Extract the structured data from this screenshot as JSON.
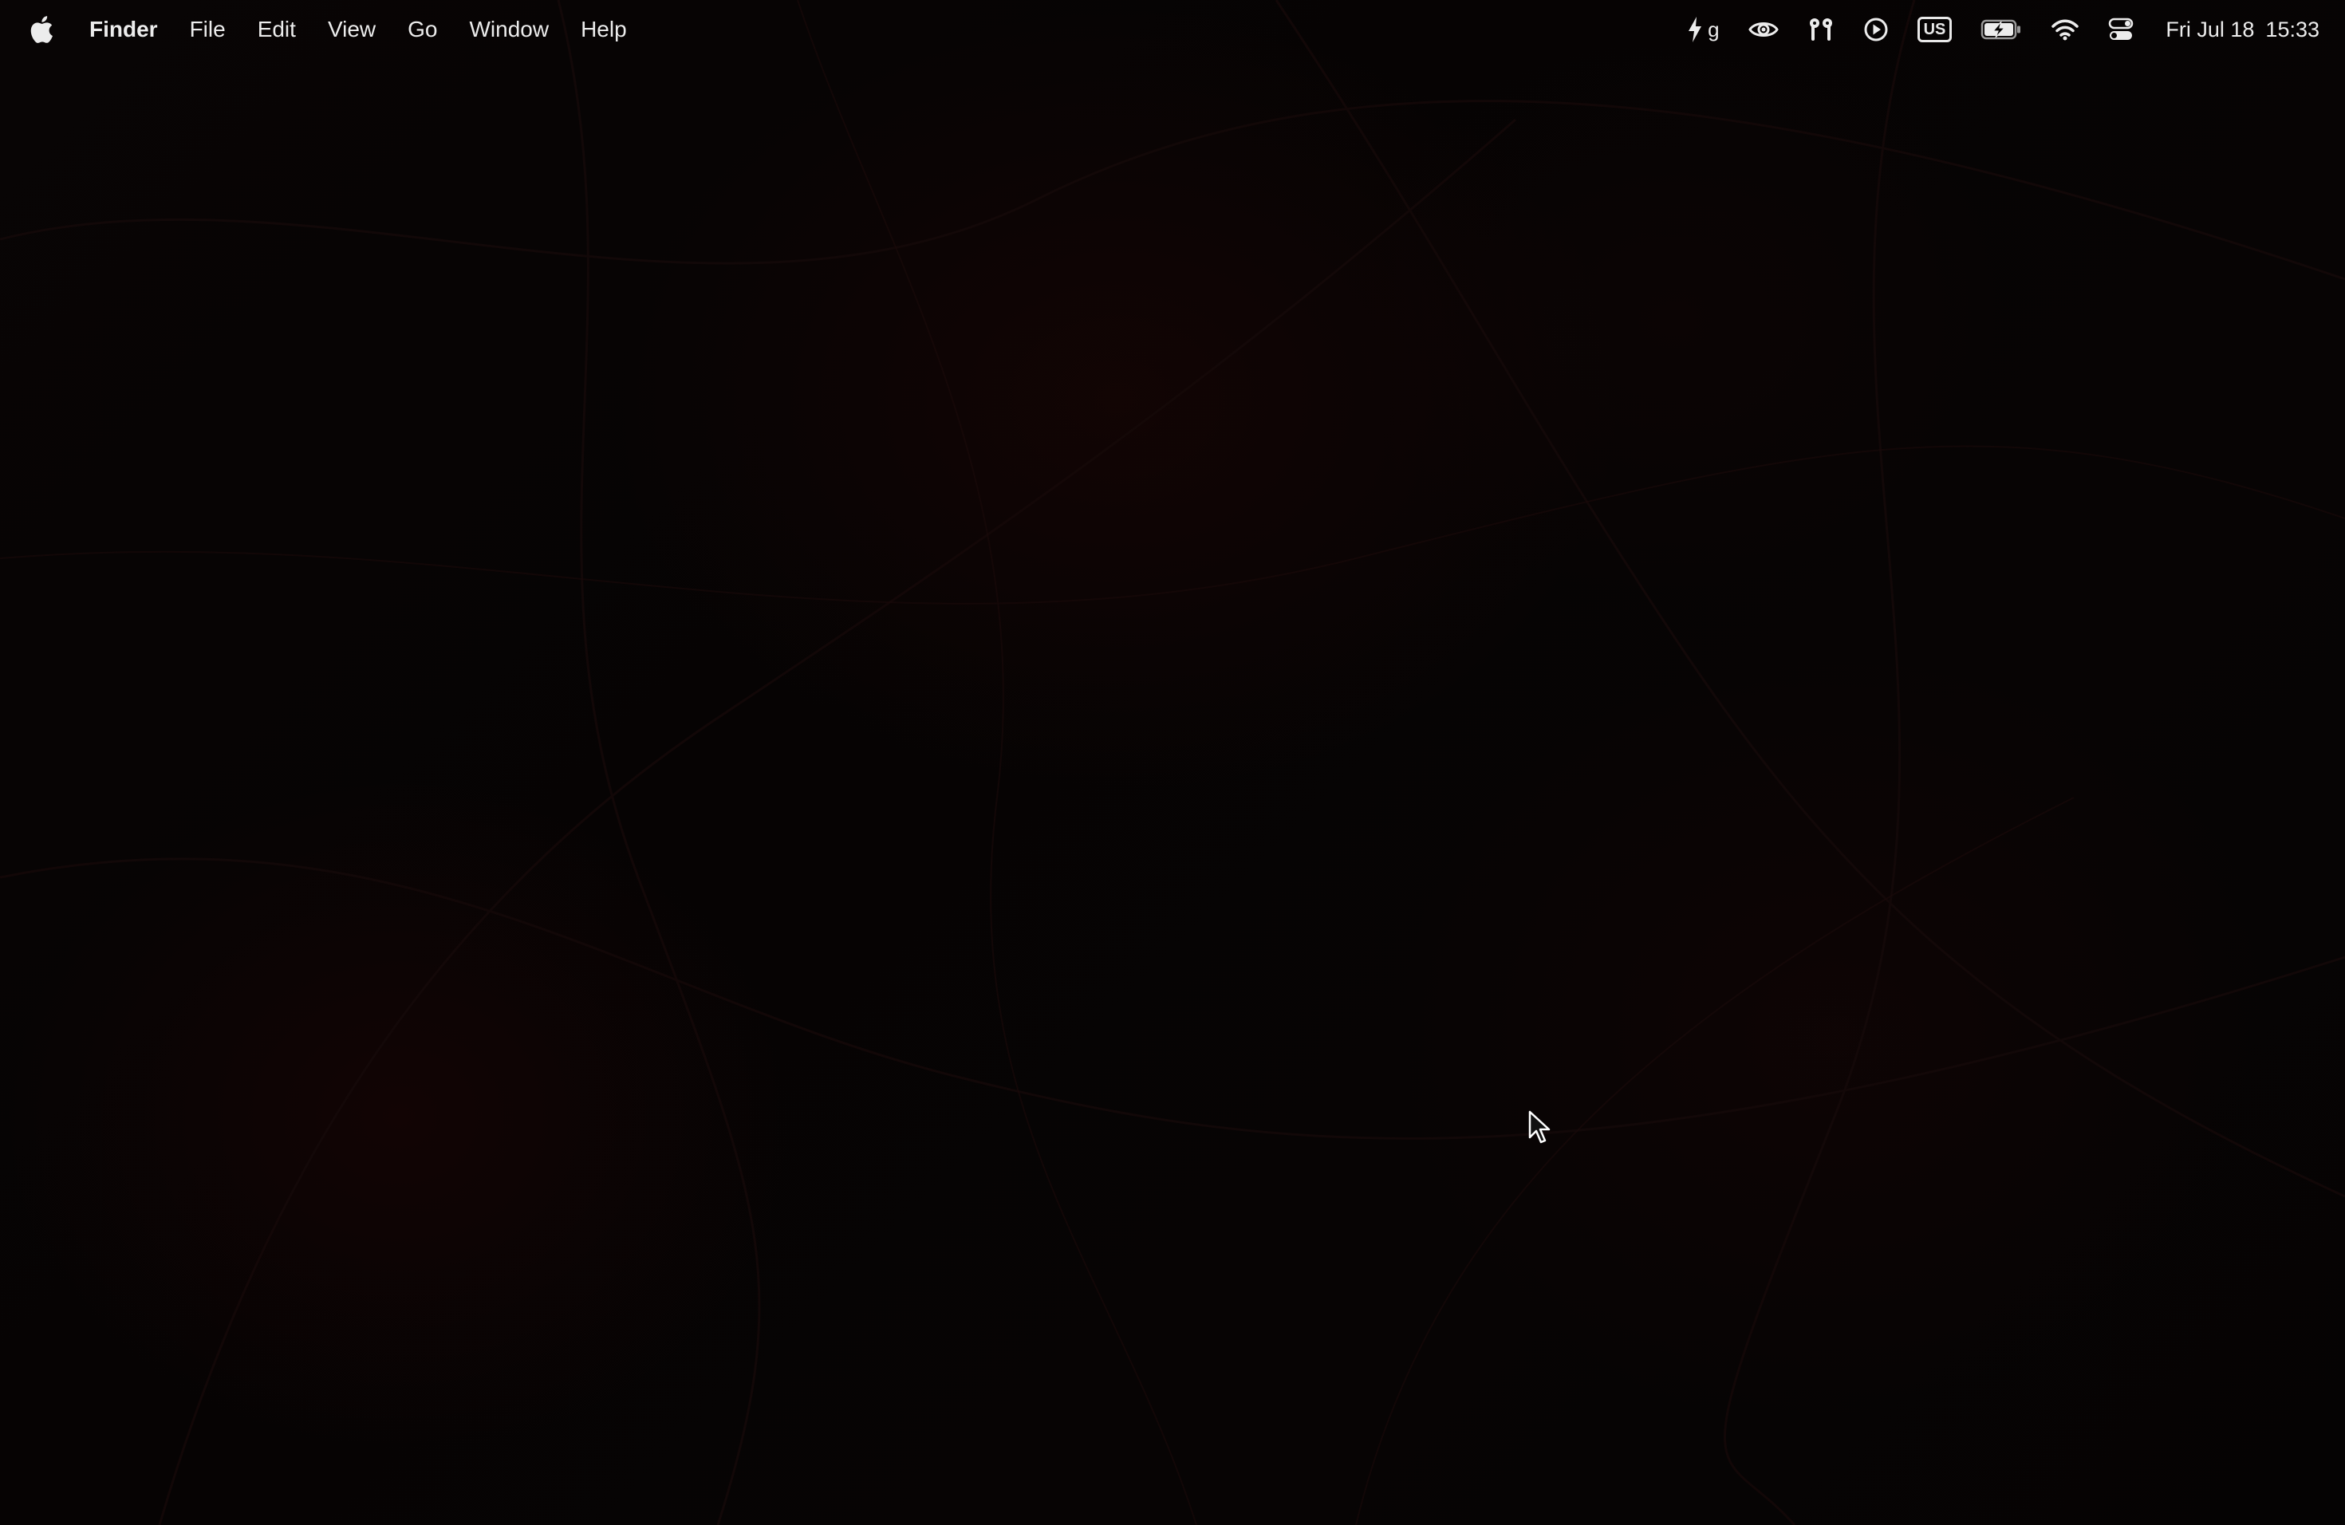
{
  "menubar": {
    "apple_icon": "apple-logo-icon",
    "app_name": "Finder",
    "menus": [
      "File",
      "Edit",
      "View",
      "Go",
      "Window",
      "Help"
    ],
    "status": {
      "energy_letter": "g",
      "keyboard_layout": "US",
      "date": "Fri Jul 18",
      "time": "15:33"
    },
    "icons": [
      "bolt-icon",
      "eye-icon",
      "airpods-icon",
      "play-circle-icon",
      "battery-charging-icon",
      "wifi-icon",
      "control-center-icon"
    ]
  },
  "desktop": {
    "background_color": "#050404",
    "accent": "#2a0606"
  }
}
